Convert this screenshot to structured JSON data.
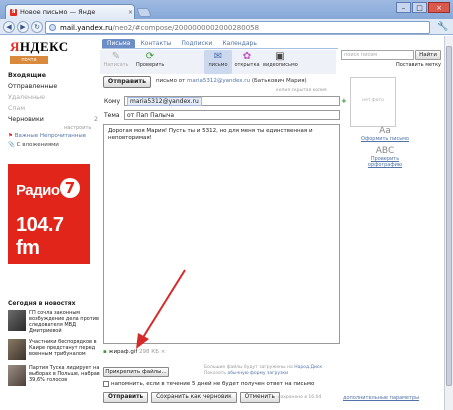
{
  "browser": {
    "tab_title": "Новое письмо — Янде",
    "url_domain": "mail.yandex.ru",
    "url_rest": "/neo2/#compose/2000000002000280058"
  },
  "logo": {
    "text_main": "ЯНДЕКС",
    "text_sub": "почта",
    "accent": "#e52b1e"
  },
  "sidebar": {
    "folders": [
      {
        "label": "Входящие",
        "count": "",
        "state": "active"
      },
      {
        "label": "Отправленные",
        "count": "",
        "state": "normal"
      },
      {
        "label": "Удаленные",
        "count": "",
        "state": "dim"
      },
      {
        "label": "Спам",
        "count": "",
        "state": "dim"
      },
      {
        "label": "Черновики",
        "count": "2",
        "state": "normal"
      }
    ],
    "settings_link": "настроить",
    "labels_line_important": "Важные",
    "labels_line_unread": "Непрочитанные",
    "with_attachments": "С вложениями",
    "ad": {
      "radio": "Радио",
      "seven": "7",
      "freq": "104.7 fm",
      "color": "#e1251b"
    },
    "news_heading": "Сегодня в новостях",
    "news": [
      {
        "text": "ГП сочла законным возбуждение дела против следователя МВД Дмитриевой"
      },
      {
        "text": "Участники беспорядков в Каире предстанут перед военным трибуналом"
      },
      {
        "text": "Партия Туска лидирует на выборах в Польше, набрав 39,6% голосов"
      }
    ]
  },
  "tabs": [
    "Письма",
    "Контакты",
    "Подписки",
    "Календарь"
  ],
  "search": {
    "placeholder": "поиск писем",
    "button": "Найти",
    "set_label": "Поставить метку"
  },
  "toolbar": [
    {
      "label": "Написать",
      "icon": "write-icon",
      "glyph": "✎",
      "state": "dim"
    },
    {
      "label": "Проверить",
      "icon": "refresh-icon",
      "glyph": "⟳",
      "state": "normal"
    },
    {
      "label": "письмо",
      "icon": "letter-icon",
      "glyph": "✉",
      "state": "sel"
    },
    {
      "label": "открытка",
      "icon": "postcard-icon",
      "glyph": "✿",
      "state": "normal"
    },
    {
      "label": "видеописьмо",
      "icon": "video-icon",
      "glyph": "▣",
      "state": "normal"
    }
  ],
  "compose": {
    "send_label": "Отправить",
    "from_prefix": "письмо от",
    "from_email": "maria5312@yandex.ru",
    "from_name": "(Батькович Мария)",
    "copy_links": "копия  скрытая копия",
    "to_label": "Кому",
    "to_value": "maria5312@yandex.ru",
    "subject_label": "Тема",
    "subject_value": "от Пап Палыча",
    "photo_placeholder": "нет фото",
    "body": "Дорогая моя Мария! Пусть ты и 5312, но для меня ты единственная и неповторимая!",
    "format_label": "Оформить письмо",
    "spell_label": "Проверить орфографию",
    "attachment": {
      "name": "жираф.gif",
      "size": "298 КБ"
    },
    "attach_note_1": "Большие файлы будут загружены на",
    "attach_note_disk": "Народ.Диск",
    "attach_note_2": "Показать",
    "attach_note_link": "обычную форму загрузки",
    "attach_button": "Прикрепить файлы...",
    "remind_text": "напомнить, если в течение 5 дней не будет получен ответ на письмо",
    "btn_send": "Отправить",
    "btn_draft": "Сохранить как черновик",
    "btn_cancel": "Отменить",
    "saved_text": "сохранено в 16:04",
    "extra_params": "дополнительные параметры"
  }
}
